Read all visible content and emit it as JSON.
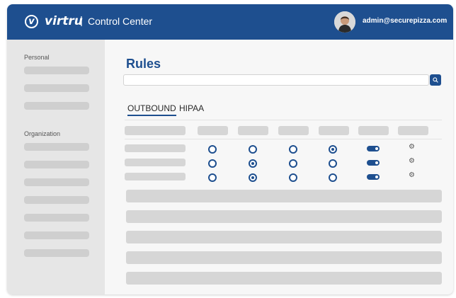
{
  "app": {
    "logo_mark": "v",
    "logo_name": "virtru",
    "separator": "|",
    "section_title": "Control Center"
  },
  "user": {
    "email": "admin@securepizza.com",
    "avatar_icon": "user-avatar-icon"
  },
  "sidebar": {
    "personal_label": "Personal",
    "organization_label": "Organization"
  },
  "main": {
    "title": "Rules",
    "search": {
      "value": "",
      "placeholder": "",
      "button_icon": "search-icon"
    },
    "tabs": [
      {
        "label": "OUTBOUND",
        "active": true
      },
      {
        "label": "HIPAA",
        "active": false
      }
    ]
  },
  "rules": {
    "rows": [
      {
        "radios": [
          false,
          false,
          false,
          true
        ],
        "toggle_on": true,
        "settings_icon": "gear-icon"
      },
      {
        "radios": [
          false,
          true,
          false,
          false
        ],
        "toggle_on": true,
        "settings_icon": "gear-icon"
      },
      {
        "radios": [
          false,
          true,
          false,
          false
        ],
        "toggle_on": true,
        "settings_icon": "gear-icon"
      }
    ]
  },
  "colors": {
    "brand": "#1e4f8f",
    "placeholder": "#d6d6d6",
    "sidebar": "#e6e6e6"
  }
}
